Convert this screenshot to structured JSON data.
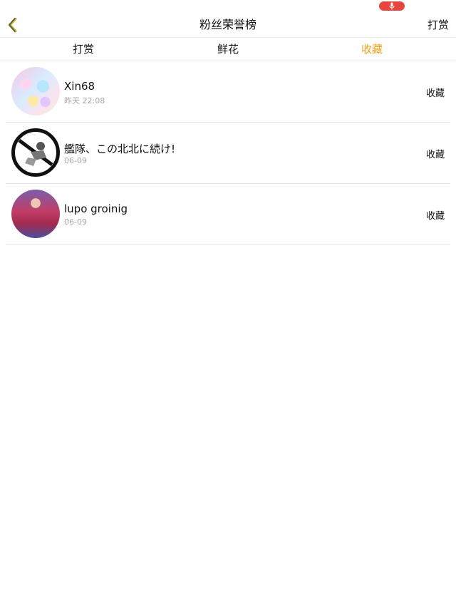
{
  "status_bar": {
    "mic_indicator_color": "#e5463f"
  },
  "nav": {
    "back_icon": "chevron-left-double-icon",
    "title": "粉丝荣誉榜",
    "right_label": "打赏"
  },
  "tabs": [
    {
      "label": "打赏",
      "active": false
    },
    {
      "label": "鲜花",
      "active": false
    },
    {
      "label": "收藏",
      "active": true
    }
  ],
  "colors": {
    "accent": "#f0a21e",
    "status_red": "#e5463f",
    "secondary_text": "#a7a7a7"
  },
  "list": [
    {
      "name": "Xin68",
      "time": "昨天 22:08",
      "action": "收藏"
    },
    {
      "name": "艦隊、この北北に続け!",
      "time": "06-09",
      "action": "收藏"
    },
    {
      "name": "lupo groinig",
      "time": "06-09",
      "action": "收藏"
    }
  ]
}
